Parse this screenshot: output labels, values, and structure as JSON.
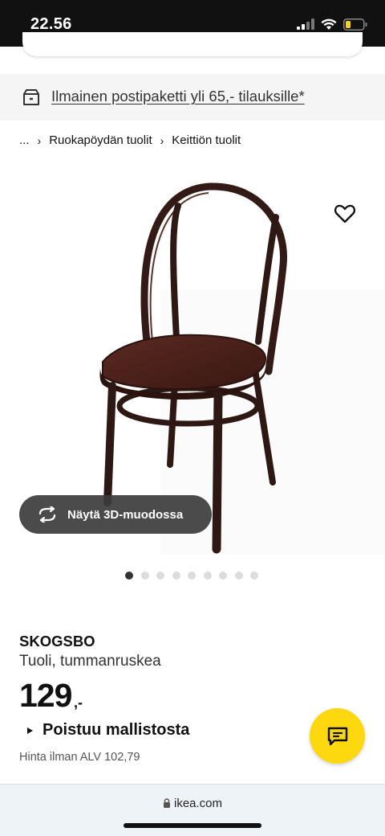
{
  "status_bar": {
    "time": "22.56",
    "icons": [
      "signal-icon",
      "wifi-icon",
      "battery-icon"
    ],
    "battery_color": "#f7d21a"
  },
  "promo": {
    "icon": "delivery-box-icon",
    "text": "Ilmainen postipaketti yli 65,- tilauksille*"
  },
  "breadcrumb": {
    "items": [
      "...",
      "Ruokapöydän tuolit",
      "Keittiön tuolit"
    ]
  },
  "gallery": {
    "wishlist_icon": "heart-icon",
    "view3d_label": "Näytä 3D-muodossa",
    "view3d_icon": "rotate-icon",
    "dot_count": 9,
    "active_index": 0
  },
  "product": {
    "name": "SKOGSBO",
    "description": "Tuoli, tummanruskea",
    "price": "129",
    "price_suffix": ",-",
    "status": "Poistuu mallistosta",
    "vat_text": "Hinta ilman ALV 102,79"
  },
  "chat": {
    "icon": "chat-bubble-icon",
    "color": "#fdd80e"
  },
  "browser": {
    "url": "ikea.com"
  }
}
